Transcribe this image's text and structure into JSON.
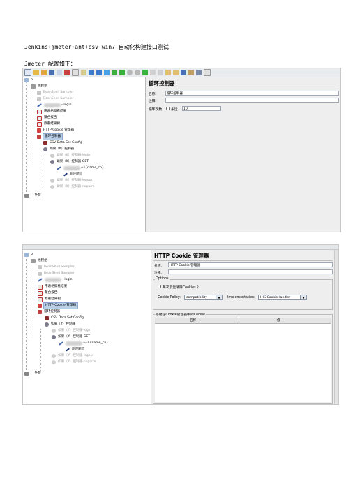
{
  "doc": {
    "title": "Jenkins+jmeter+ant+csv+win7 自动化构建接口测试",
    "subtitle": "Jmeter 配置如下："
  },
  "tree": {
    "root": "b",
    "thread_group": "线程组",
    "shell1": "BeanShell Sampler",
    "shell2": "BeanShell Sampler",
    "login_sampler": "--login",
    "listener1": "用表格察看结果",
    "listener2": "聚合报告",
    "listener3": "察看结果树",
    "cookie_manager": "HTTP Cookie 管理器",
    "loop_controller": "循环控制器",
    "csv_config": "CSV Data Set Config",
    "if1": "如果（If）控制器",
    "if_login": "如果（If）控制器-login",
    "if_get": "如果（If）控制器-GET",
    "get_sampler_1": "--${name_cn}",
    "get_sampler_2": "----${name_cn}",
    "assertion": "响应断言",
    "if_logout": "如果（If）控制器-logout",
    "if_noparm": "如果（If）控制器-noparm",
    "workbench": "工作台"
  },
  "loop_panel": {
    "title": "循环控制器",
    "name_label": "名称：",
    "name_value": "循环控制器",
    "comment_label": "注释：",
    "loop_label": "循环次数",
    "forever_label": "永远",
    "loop_value": "10"
  },
  "cookie_panel": {
    "title": "HTTP Cookie 管理器",
    "name_label": "名称：",
    "name_value": "HTTP Cookie 管理器",
    "comment_label": "注释：",
    "options_label": "Options",
    "clear_label": "每次反复清除Cookies ？",
    "policy_label": "Cookie Policy:",
    "policy_value": "compatibility",
    "impl_label": "Implementation:",
    "impl_value": "HC3CookieHandler",
    "stored_label": "存储在Cookie管理器中的Cookie",
    "col_name": "名称：",
    "col_value": "值"
  },
  "colors": {
    "selection": "#b9cfe8",
    "panel_bg": "#eeeeee",
    "tree_bg": "#ffffff"
  }
}
